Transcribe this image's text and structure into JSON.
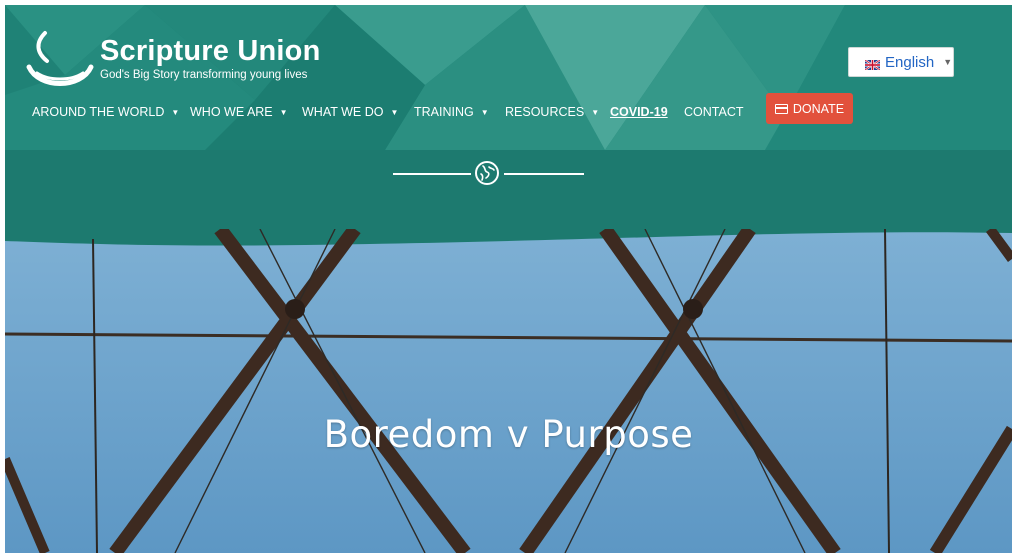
{
  "brand": {
    "title": "Scripture Union",
    "tagline": "God's Big Story transforming young lives"
  },
  "language": {
    "selected": "English"
  },
  "nav": {
    "items": [
      {
        "label": "AROUND THE WORLD",
        "has_dropdown": true
      },
      {
        "label": "WHO WE ARE",
        "has_dropdown": true
      },
      {
        "label": "WHAT WE DO",
        "has_dropdown": true
      },
      {
        "label": "TRAINING",
        "has_dropdown": true
      },
      {
        "label": "RESOURCES",
        "has_dropdown": true
      },
      {
        "label": "COVID-19",
        "has_dropdown": false
      },
      {
        "label": "CONTACT",
        "has_dropdown": false
      }
    ],
    "donate_label": "DONATE"
  },
  "hero": {
    "title": "Boredom v Purpose"
  },
  "icons": {
    "logo": "lamp-logo-icon",
    "language_flag": "uk-flag-icon",
    "caret": "chevron-down-icon",
    "donate": "card-icon",
    "divider": "globe-icon"
  },
  "colors": {
    "header_teal": "#1f8276",
    "band_teal": "#1d7a6f",
    "donate_red": "#e2513c",
    "language_link": "#2366c4",
    "sky_blue": "#6fa3cb"
  }
}
